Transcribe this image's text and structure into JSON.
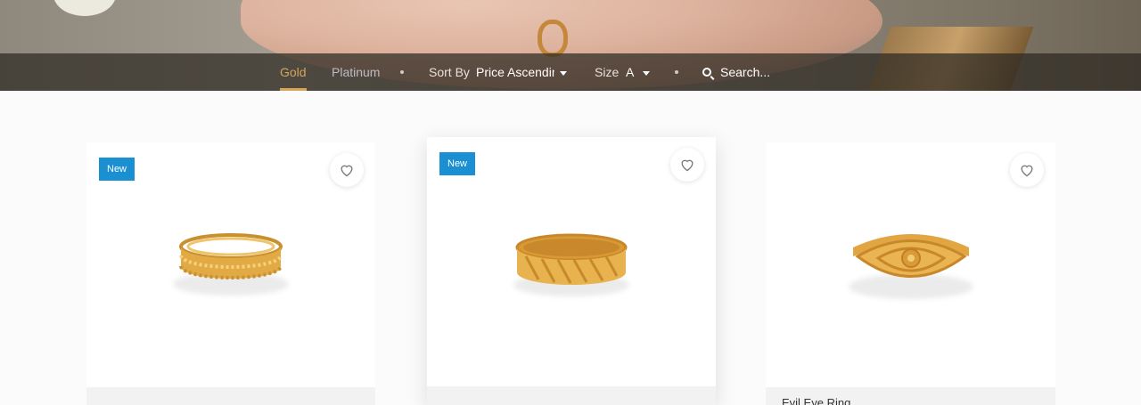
{
  "filter_bar": {
    "tabs": [
      {
        "label": "Gold",
        "active": true
      },
      {
        "label": "Platinum",
        "active": false
      }
    ],
    "sort": {
      "label": "Sort By",
      "value": "Price Ascending"
    },
    "size": {
      "label": "Size",
      "value": "A"
    },
    "search": {
      "placeholder": "Search..."
    }
  },
  "products": [
    {
      "badge": "New",
      "title": ""
    },
    {
      "badge": "New",
      "title": ""
    },
    {
      "badge": "",
      "title": "Evil Eye Ring"
    }
  ],
  "colors": {
    "accent_gold": "#d8a45a",
    "badge_blue": "#1a8fd1"
  }
}
